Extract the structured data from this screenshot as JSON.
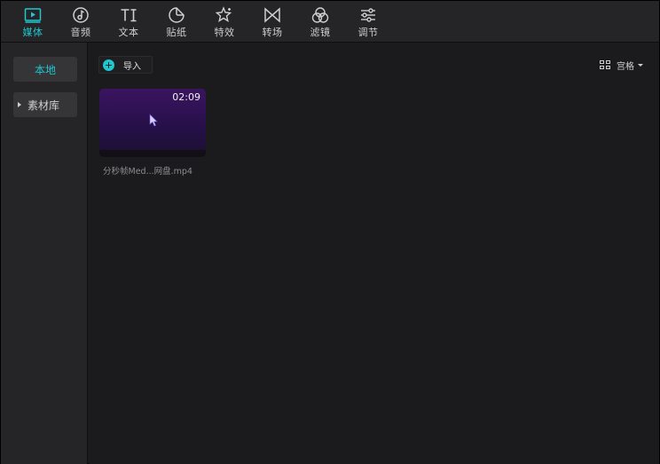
{
  "tabs": [
    {
      "label": "媒体",
      "icon": "media-play-icon",
      "active": true
    },
    {
      "label": "音频",
      "icon": "audio-note-icon",
      "active": false
    },
    {
      "label": "文本",
      "icon": "text-ti-icon",
      "active": false
    },
    {
      "label": "贴纸",
      "icon": "sticker-icon",
      "active": false
    },
    {
      "label": "特效",
      "icon": "effects-star-icon",
      "active": false
    },
    {
      "label": "转场",
      "icon": "transition-bowtie-icon",
      "active": false
    },
    {
      "label": "滤镜",
      "icon": "filter-circles-icon",
      "active": false
    },
    {
      "label": "调节",
      "icon": "adjust-sliders-icon",
      "active": false
    }
  ],
  "sidebar": {
    "local_label": "本地",
    "library_label": "素材库"
  },
  "toolbar": {
    "import_label": "导入",
    "view_label": "宫格"
  },
  "media": [
    {
      "duration": "02:09",
      "file_name": "分秒帧Med...网盘.mp4"
    }
  ],
  "colors": {
    "accent": "#21c6cf",
    "background": "#1b1b1d",
    "panel": "#252528"
  }
}
